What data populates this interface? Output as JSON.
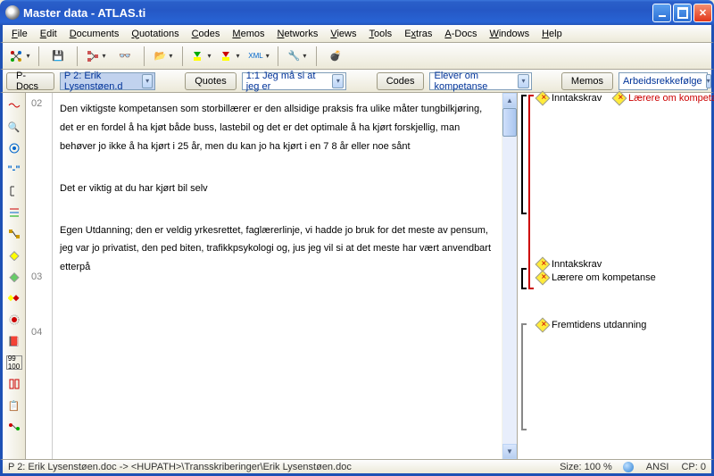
{
  "window": {
    "title": "Master data - ATLAS.ti"
  },
  "menu": {
    "file": "File",
    "edit": "Edit",
    "documents": "Documents",
    "quotations": "Quotations",
    "codes": "Codes",
    "memos": "Memos",
    "networks": "Networks",
    "views": "Views",
    "tools": "Tools",
    "extras": "Extras",
    "adocs": "A-Docs",
    "windows": "Windows",
    "help": "Help"
  },
  "toolbar2": {
    "pdocs_btn": "P-Docs",
    "pdocs_combo": "P 2: Erik Lysenstøen.d",
    "quotes_btn": "Quotes",
    "quotes_combo": "1:1 Jeg må si at jeg er",
    "codes_btn": "Codes",
    "codes_combo": "Elever om kompetanse",
    "memos_btn": "Memos",
    "memos_combo": "Arbeidsrekkefølge"
  },
  "margin": {
    "p02": "02",
    "p03": "03",
    "p04": "04"
  },
  "document": {
    "para1": "Den viktigste kompetansen som storbillærer er den allsidige praksis fra ulike måter tungbilkjøring, det er en fordel å ha kjøt både buss, lastebil og det er det optimale å ha kjørt forskjellig, man behøver jo ikke å ha kjørt i 25 år, men du kan jo ha kjørt i en 7 8 år eller noe sånt",
    "para2": "Det er viktig at du har kjørt bil selv",
    "para3": "Egen Utdanning; den er veldig yrkesrettet, faglærerlinje, vi hadde jo bruk for det meste av pensum, jeg var jo privatist, den ped biten, trafikkpsykologi og, jus jeg vil si at det meste har vært anvendbart etterpå"
  },
  "codes": {
    "c1a": "Inntakskrav",
    "c1b": "Lærere om kompetanse",
    "c2a": "Inntakskrav",
    "c2b": "Lærere om kompetanse",
    "c3": "Fremtidens utdanning"
  },
  "status": {
    "path": "P 2: Erik Lysenstøen.doc -> <HUPATH>\\Transskriberinger\\Erik Lysenstøen.doc",
    "size": "Size: 100 %",
    "enc": "ANSI",
    "cp": "CP: 0"
  },
  "left_icons": {
    "i5_label": "\"-\""
  },
  "icons": {
    "xml": "XML"
  }
}
